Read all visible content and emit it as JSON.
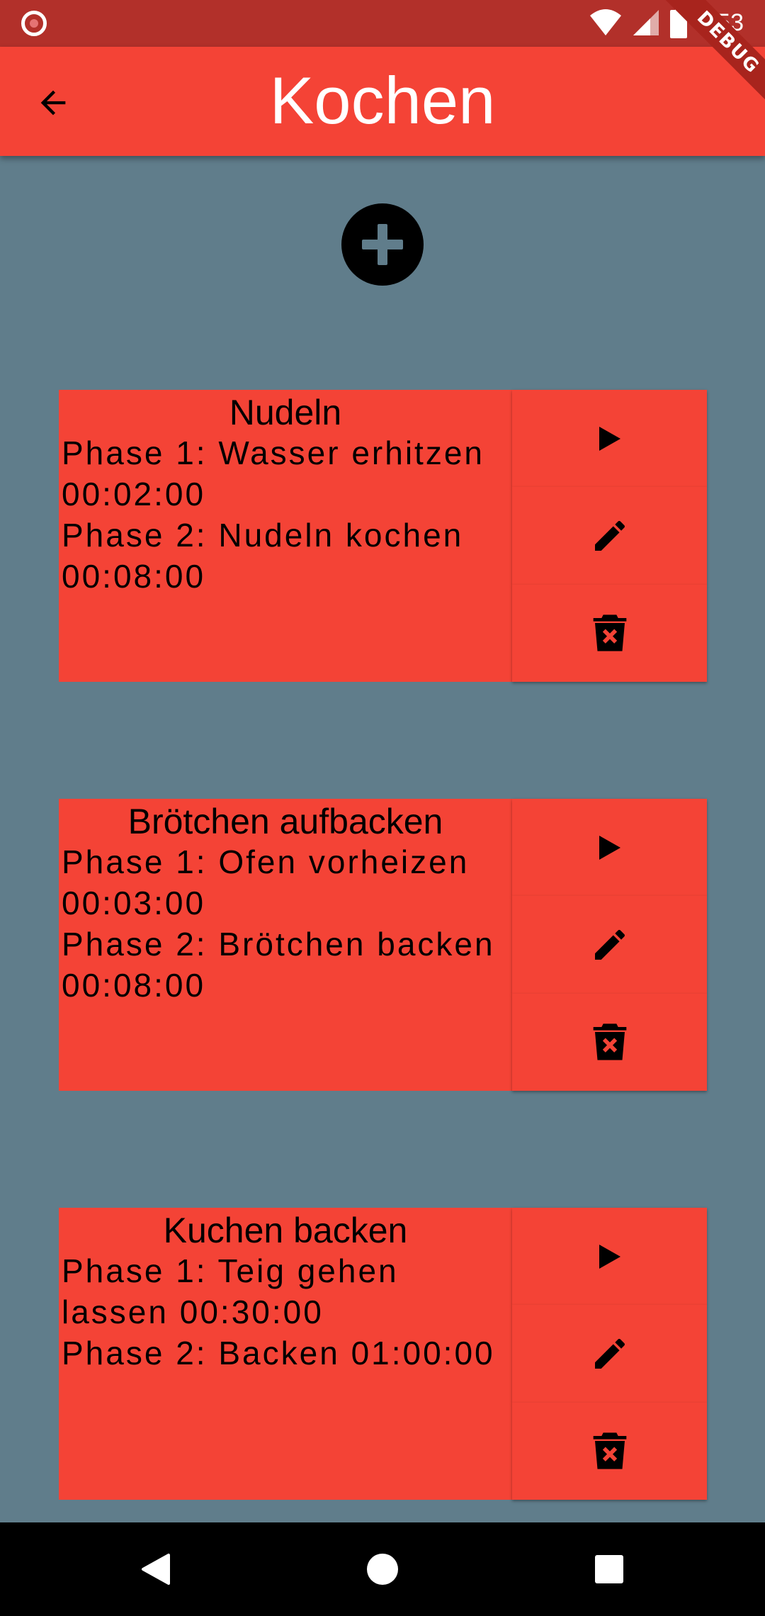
{
  "status_bar": {
    "time": "2:53",
    "debug_label": "DEBUG"
  },
  "app_bar": {
    "title": "Kochen"
  },
  "recipes": [
    {
      "name": "Nudeln",
      "phases": [
        "Phase 1: Wasser erhitzen 00:02:00",
        "Phase 2: Nudeln kochen 00:08:00"
      ]
    },
    {
      "name": "Brötchen aufbacken",
      "phases": [
        "Phase 1: Ofen vorheizen 00:03:00",
        "Phase 2: Brötchen backen 00:08:00"
      ]
    },
    {
      "name": "Kuchen backen",
      "phases": [
        "Phase 1: Teig gehen lassen 00:30:00",
        "Phase 2: Backen 01:00:00"
      ]
    }
  ],
  "colors": {
    "primary": "#F44336",
    "status_bar": "#B2302A",
    "background": "#607D8B"
  },
  "icons": {
    "back": "arrow-left-icon",
    "add": "plus-circle-icon",
    "play": "play-icon",
    "edit": "pencil-icon",
    "delete": "trash-icon"
  }
}
